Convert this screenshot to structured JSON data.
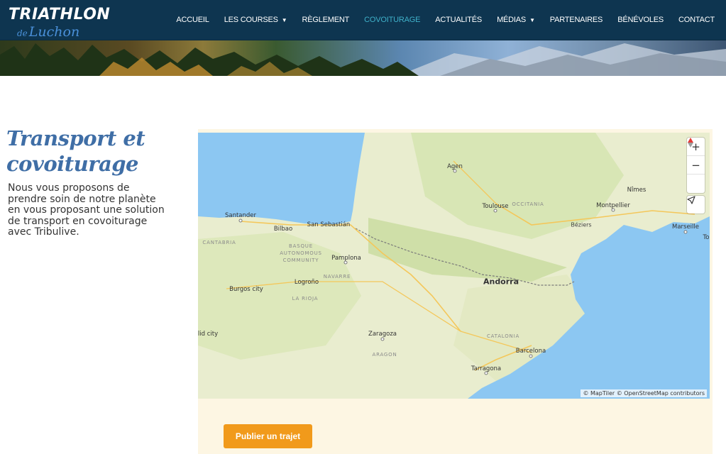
{
  "header": {
    "logo_main": "TRIATHLON",
    "logo_de": "de",
    "logo_place": "Luchon"
  },
  "nav": {
    "items": [
      {
        "label": "ACCUEIL",
        "dropdown": false,
        "active": false
      },
      {
        "label": "LES COURSES",
        "dropdown": true,
        "active": false
      },
      {
        "label": "RÈGLEMENT",
        "dropdown": false,
        "active": false
      },
      {
        "label": "COVOITURAGE",
        "dropdown": false,
        "active": true
      },
      {
        "label": "ACTUALITÉS",
        "dropdown": false,
        "active": false
      },
      {
        "label": "MÉDIAS",
        "dropdown": true,
        "active": false
      },
      {
        "label": "PARTENAIRES",
        "dropdown": false,
        "active": false
      },
      {
        "label": "BÉNÉVOLES",
        "dropdown": false,
        "active": false
      },
      {
        "label": "CONTACT",
        "dropdown": false,
        "active": false
      }
    ],
    "active_color": "#3fb0c9",
    "caret_icon": "chevron-down-icon"
  },
  "intro": {
    "title": "Transport et covoiturage",
    "text": "Nous vous proposons de prendre soin de notre planète en vous proposant une solution de transport en covoiturage avec Tribulive."
  },
  "map": {
    "zoom_in": "+",
    "zoom_out": "−",
    "compass_icon": "compass-icon",
    "locate_icon": "locate-arrow-icon",
    "attribution": "© MapTiler © OpenStreetMap contributors",
    "labels": {
      "agen": "Agen",
      "toulouse": "Toulouse",
      "occitania": "OCCITANIA",
      "nimes": "Nîmes",
      "montpellier": "Montpellier",
      "beziers": "Béziers",
      "marseille": "Marseille",
      "santander": "Santander",
      "bilbao": "Bilbao",
      "san_sebastian": "San Sebastián",
      "cantabria": "CANTABRIA",
      "basque": "BASQUE",
      "autonomous": "AUTONOMOUS",
      "community": "COMMUNITY",
      "pamplona": "Pamplona",
      "navarre": "NAVARRE",
      "andorra": "Andorra",
      "burgos": "Burgos city",
      "logrono": "Logroño",
      "la_rioja": "LA RIOJA",
      "madrid": "lid city",
      "zaragoza": "Zaragoza",
      "catalonia": "CATALONIA",
      "aragon": "ARAGON",
      "barcelona": "Barcelona",
      "tarragona": "Tarragona",
      "to": "To"
    }
  },
  "cta": {
    "publish_label": "Publier un trajet",
    "color": "#f19a1b"
  }
}
